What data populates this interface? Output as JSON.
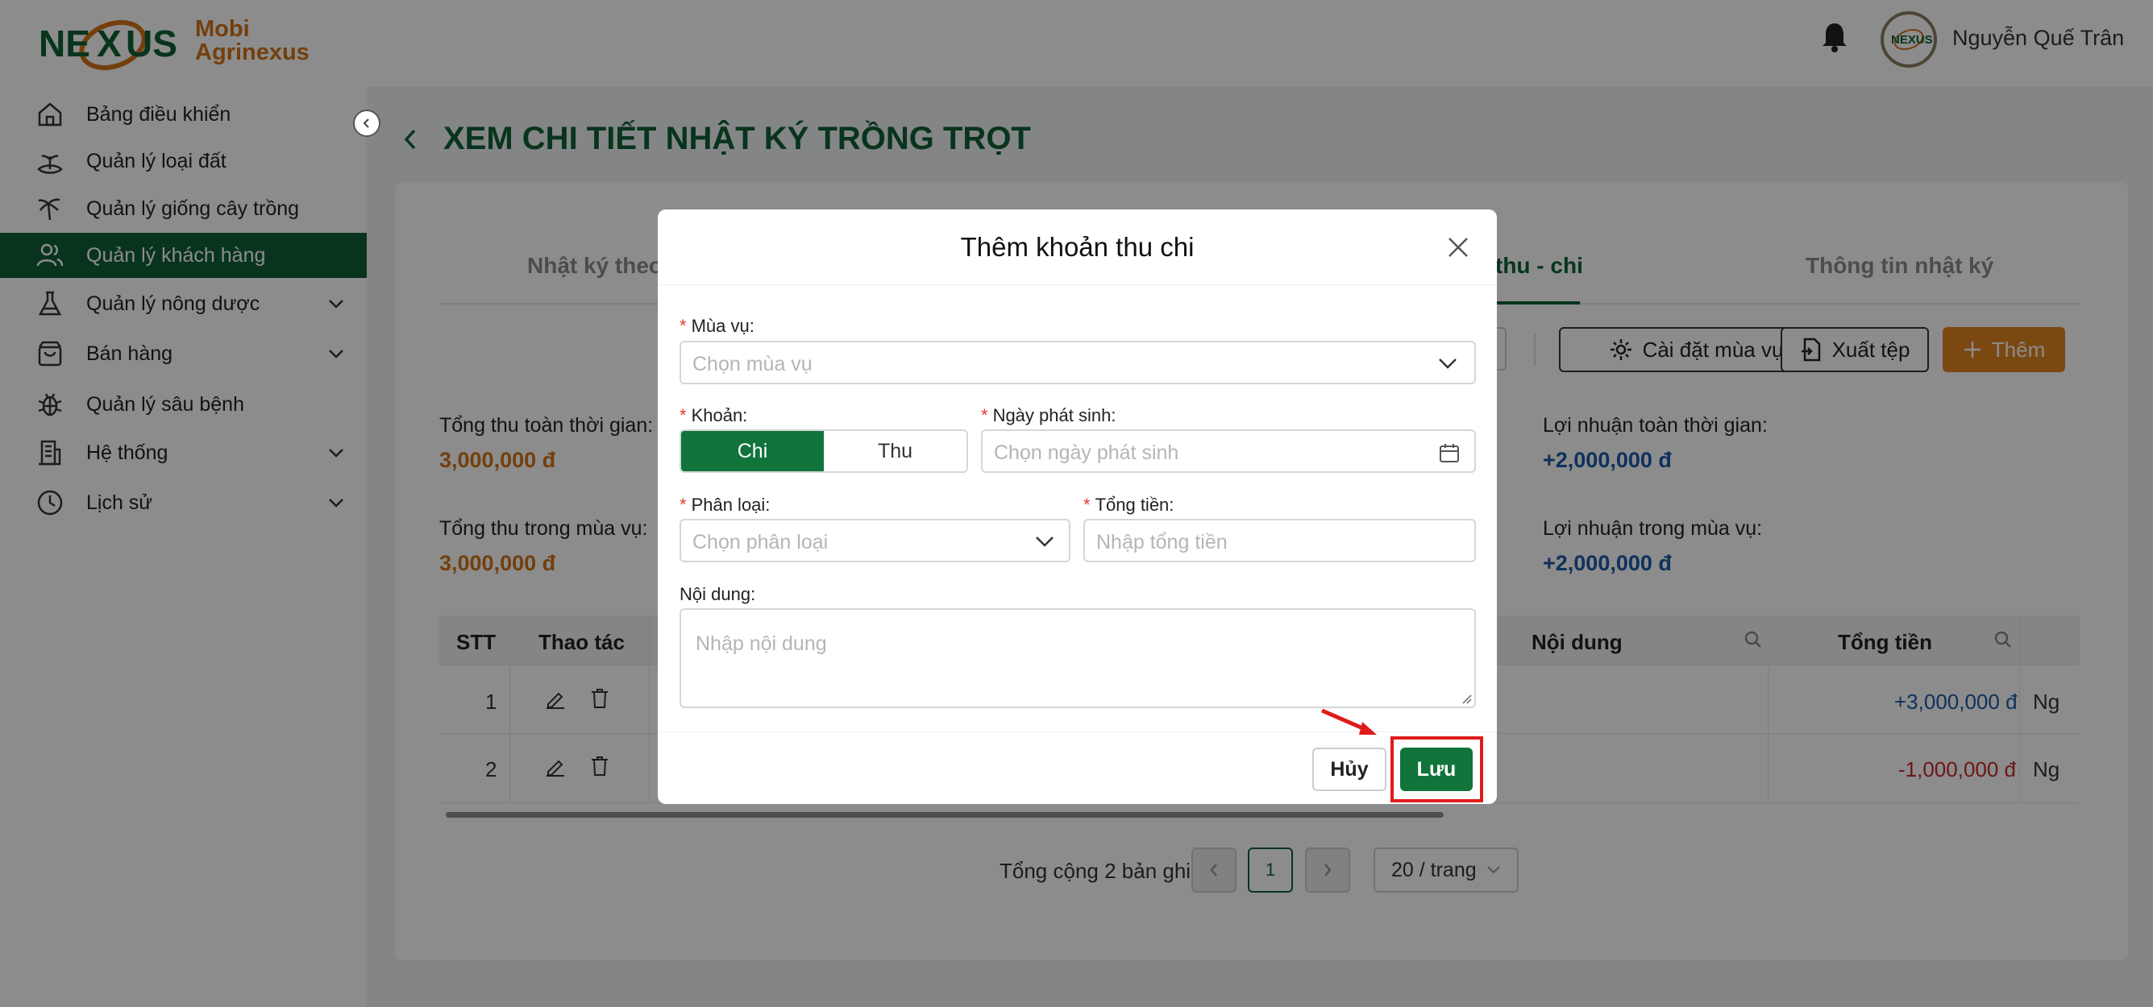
{
  "header": {
    "brand_line1": "Mobi",
    "brand_line2": "Agrinexus",
    "logo_text": "NEXUS",
    "user_name": "Nguyễn Quế Trân"
  },
  "sidebar": {
    "items": [
      {
        "label": "Bảng điều khiển",
        "icon": "home-icon"
      },
      {
        "label": "Quản lý loại đất",
        "icon": "soil-icon"
      },
      {
        "label": "Quản lý giống cây trồng",
        "icon": "palm-tree-icon"
      },
      {
        "label": "Quản lý khách hàng",
        "icon": "users-icon",
        "active": true
      },
      {
        "label": "Quản lý nông dược",
        "icon": "flask-icon",
        "expandable": true
      },
      {
        "label": "Bán hàng",
        "icon": "shopping-bag-icon",
        "expandable": true
      },
      {
        "label": "Quản lý sâu bệnh",
        "icon": "bug-icon"
      },
      {
        "label": "Hệ thống",
        "icon": "building-icon",
        "expandable": true
      },
      {
        "label": "Lịch sử",
        "icon": "clock-icon",
        "expandable": true
      }
    ]
  },
  "page": {
    "title": "XEM CHI TIẾT NHẬT KÝ TRỒNG TRỌT",
    "tabs": [
      "Nhật ký theo",
      "thu - chi",
      "Thông tin nhật ký"
    ],
    "toolbar": {
      "season_settings": "Cài đặt mùa vụ",
      "export": "Xuất tệp",
      "add": "Thêm"
    },
    "stats": {
      "total_income_all_label": "Tổng thu toàn thời gian:",
      "total_income_all_value": "3,000,000 đ",
      "total_income_season_label": "Tổng thu trong mùa vụ:",
      "total_income_season_value": "3,000,000 đ",
      "profit_all_label": "Lợi nhuận toàn thời gian:",
      "profit_all_value": "+2,000,000 đ",
      "profit_season_label": "Lợi nhuận trong mùa vụ:",
      "profit_season_value": "+2,000,000 đ"
    },
    "table": {
      "columns": [
        "STT",
        "Thao tác",
        "Nội dung",
        "Tổng tiền"
      ],
      "rows": [
        {
          "stt": "1",
          "amount": "+3,000,000 đ",
          "trail": "Ng"
        },
        {
          "stt": "2",
          "amount": "-1,000,000 đ",
          "trail": "Ng"
        }
      ]
    },
    "pagination": {
      "total": "Tổng cộng 2 bản ghi",
      "current": "1",
      "page_size": "20 / trang"
    }
  },
  "modal": {
    "title": "Thêm khoản thu chi",
    "season_label": "Mùa vụ:",
    "season_placeholder": "Chọn mùa vụ",
    "type_label": "Khoản:",
    "type_options": [
      "Chi",
      "Thu"
    ],
    "date_label": "Ngày phát sinh:",
    "date_placeholder": "Chọn ngày phát sinh",
    "category_label": "Phân loại:",
    "category_placeholder": "Chọn phân loại",
    "amount_label": "Tổng tiền:",
    "amount_placeholder": "Nhập tổng tiền",
    "content_label": "Nội dung:",
    "content_placeholder": "Nhập nội dung",
    "cancel": "Hủy",
    "save": "Lưu"
  },
  "colors": {
    "primary_green": "#0f5f35",
    "accent_orange": "#e08322",
    "highlight_red": "#e01b1b"
  }
}
